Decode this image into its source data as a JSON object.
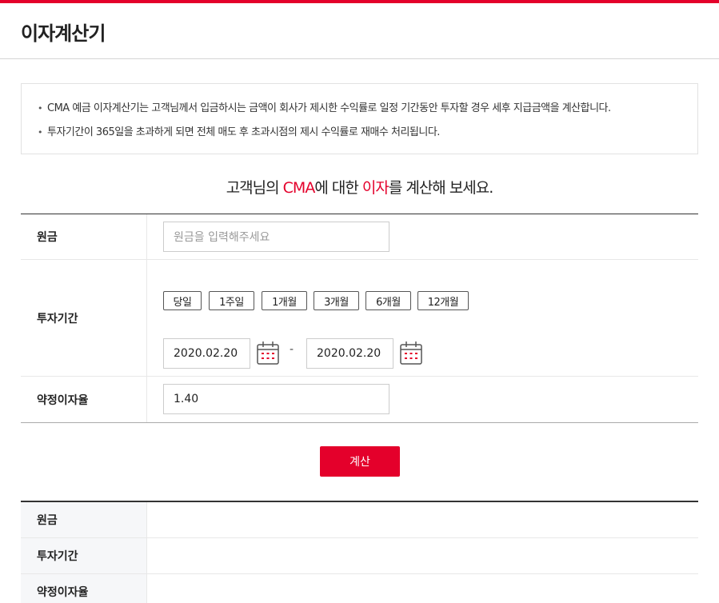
{
  "brand": {
    "accent": "#e4002b"
  },
  "header": {
    "title": "이자계산기"
  },
  "notice": {
    "items": [
      "CMA 예금 이자계산기는 고객님께서 입금하시는 금액이 회사가 제시한 수익률로 일정 기간동안 투자할 경우 세후 지급금액을 계산합니다.",
      "투자기간이 365일을 초과하게 되면 전체 매도 후 초과시점의 제시 수익률로 재매수 처리됩니다."
    ]
  },
  "headline": {
    "prefix": "고객님의 ",
    "hl1": "CMA",
    "mid": "에 대한 ",
    "hl2": "이자",
    "suffix": "를 계산해 보세요."
  },
  "form": {
    "principal": {
      "label": "원금",
      "placeholder": "원금을 입력해주세요",
      "value": ""
    },
    "period": {
      "label": "투자기간",
      "buttons": [
        "당일",
        "1주일",
        "1개월",
        "3개월",
        "6개월",
        "12개월"
      ],
      "start_date": "2020.02.20",
      "separator": "-",
      "end_date": "2020.02.20",
      "calendar_icon": "calendar-icon"
    },
    "rate": {
      "label": "약정이자율",
      "value": "1.40"
    }
  },
  "calculate_button": "계산",
  "results": {
    "rows": [
      {
        "label": "원금",
        "value": ""
      },
      {
        "label": "투자기간",
        "value": ""
      },
      {
        "label": "약정이자율",
        "value": ""
      }
    ]
  }
}
